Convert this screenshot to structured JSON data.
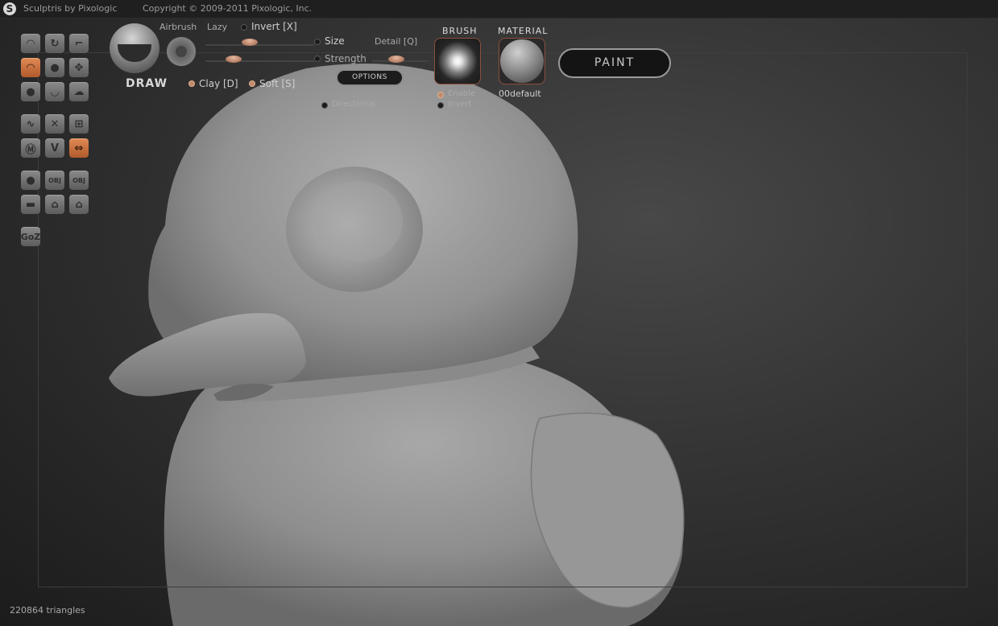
{
  "titlebar": {
    "app_title": "Sculptris by Pixologic",
    "copyright": "Copyright © 2009-2011 Pixologic, Inc."
  },
  "toolbar": {
    "tools": [
      {
        "id": "draw",
        "icon": "draw-icon",
        "active": false
      },
      {
        "id": "rotate",
        "icon": "rotate-icon",
        "active": false
      },
      {
        "id": "scale",
        "icon": "scale-icon",
        "active": false
      },
      {
        "id": "draw-active",
        "icon": "draw-icon",
        "active": true
      },
      {
        "id": "flatten",
        "icon": "flatten-icon",
        "active": false
      },
      {
        "id": "grab",
        "icon": "grab-icon",
        "active": false
      },
      {
        "id": "pinch",
        "icon": "pinch-icon",
        "active": false
      },
      {
        "id": "crease",
        "icon": "crease-icon",
        "active": false
      },
      {
        "id": "inflate",
        "icon": "inflate-icon",
        "active": false
      },
      {
        "id": "smooth",
        "icon": "smooth-icon",
        "active": false
      },
      {
        "id": "reduce",
        "icon": "reduce-icon",
        "active": false
      },
      {
        "id": "wireframe",
        "icon": "wireframe-icon",
        "active": false
      },
      {
        "id": "mask",
        "icon": "mask-icon",
        "active": false
      },
      {
        "id": "zigzag",
        "icon": "zigzag-icon",
        "active": false
      },
      {
        "id": "symmetry",
        "icon": "symmetry-icon",
        "active": true
      },
      {
        "id": "sphere",
        "icon": "sphere-icon",
        "active": false
      },
      {
        "id": "import-obj",
        "icon": "import-obj-icon",
        "active": false,
        "label": "OBJ"
      },
      {
        "id": "export-obj",
        "icon": "export-obj-icon",
        "active": false,
        "label": "OBJ"
      },
      {
        "id": "plane",
        "icon": "plane-icon",
        "active": false
      },
      {
        "id": "open",
        "icon": "open-icon",
        "active": false
      },
      {
        "id": "save",
        "icon": "save-icon",
        "active": false
      }
    ],
    "goz_label": "GoZ"
  },
  "brush": {
    "name": "DRAW",
    "airbrush": "Airbrush",
    "lazy": "Lazy",
    "invert": "Invert [X]",
    "size": "Size",
    "strength": "Strength",
    "detail": "Detail [Q]",
    "clay": "Clay [D]",
    "soft": "Soft [S]",
    "options": "OPTIONS",
    "directional": "Directional"
  },
  "brush_panel": {
    "header": "BRUSH",
    "enable": "Enable",
    "invert": "Invert"
  },
  "material_panel": {
    "header": "MATERIAL",
    "name": "00default"
  },
  "paint_button": "PAINT",
  "status": {
    "triangles": "220864 triangles"
  }
}
